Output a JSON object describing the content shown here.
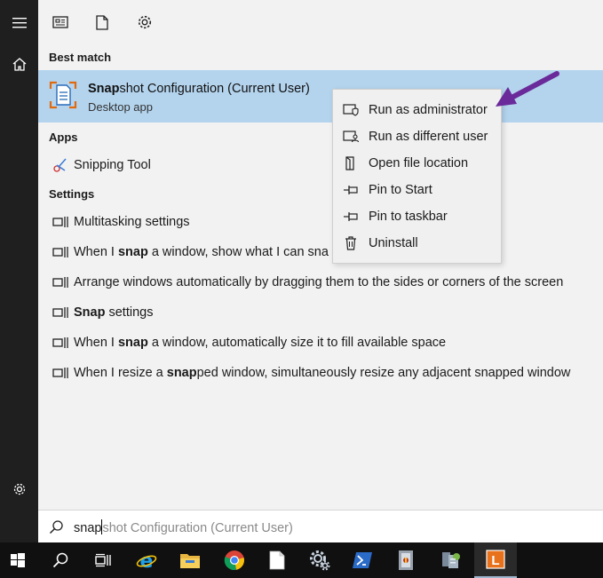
{
  "rail": {
    "menu_icon": "hamburger-icon",
    "home_icon": "home-icon",
    "settings_icon": "gear-icon"
  },
  "toolbar": {
    "icons": [
      "news-icon",
      "document-icon",
      "gear-icon"
    ]
  },
  "sections": {
    "best_match": "Best match",
    "apps": "Apps",
    "settings": "Settings"
  },
  "best_match": {
    "title_bold": "Snap",
    "title_rest": "shot Configuration (Current User)",
    "subtitle": "Desktop app"
  },
  "apps": [
    {
      "label": "Snipping Tool",
      "icon": "snipping-tool-icon"
    }
  ],
  "settings_items": [
    {
      "pre": "",
      "bold": "",
      "post": "Multitasking settings"
    },
    {
      "pre": "When I ",
      "bold": "snap",
      "post": " a window, show what I can sna"
    },
    {
      "pre": "",
      "bold": "",
      "post": "Arrange windows automatically by dragging them to the sides or corners of the screen"
    },
    {
      "pre": "",
      "bold": "Snap",
      "post": " settings"
    },
    {
      "pre": "When I ",
      "bold": "snap",
      "post": " a window, automatically size it to fill available space"
    },
    {
      "pre": "When I resize a ",
      "bold": "snap",
      "post": "ped window, simultaneously resize any adjacent snapped window"
    }
  ],
  "context_menu": [
    {
      "label": "Run as administrator",
      "icon": "shield-icon"
    },
    {
      "label": "Run as different user",
      "icon": "user-switch-icon"
    },
    {
      "label": "Open file location",
      "icon": "file-location-icon"
    },
    {
      "label": "Pin to Start",
      "icon": "pin-icon"
    },
    {
      "label": "Pin to taskbar",
      "icon": "pin-icon"
    },
    {
      "label": "Uninstall",
      "icon": "trash-icon"
    }
  ],
  "search": {
    "typed": "snap",
    "suggestion": "shot Configuration (Current User)"
  },
  "taskbar": {
    "items": [
      "start-icon",
      "search-icon",
      "task-view-icon",
      "internet-explorer-icon",
      "file-explorer-icon",
      "chrome-icon",
      "notepad-icon",
      "settings-tool-icon",
      "powershell-icon",
      "app-icon",
      "server-manager-icon",
      "l-app-icon"
    ]
  },
  "colors": {
    "rail": "#1f1f1f",
    "panel": "#f2f2f2",
    "selected": "#b4d4ee",
    "taskbar": "#101010",
    "annotation_arrow": "#6a2a9a"
  }
}
